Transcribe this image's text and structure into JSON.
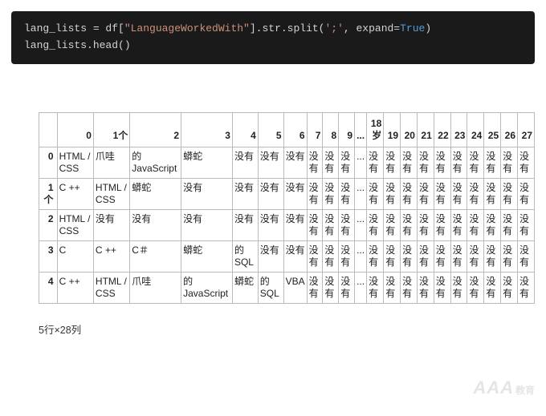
{
  "code": {
    "l1": {
      "a": "lang_lists = df[",
      "s1": "\"LanguageWorkedWith\"",
      "b": "].str.split(",
      "s2": "';'",
      "c": ", expand=",
      "kw": "True",
      "d": ")"
    },
    "l2": "lang_lists.head()"
  },
  "columns": [
    "0",
    "1个",
    "2",
    "3",
    "4",
    "5",
    "6",
    "7",
    "8",
    "9",
    "...",
    "18岁",
    "19",
    "20",
    "21",
    "22",
    "23",
    "24",
    "25",
    "26",
    "27"
  ],
  "rows": [
    {
      "idx": "0",
      "cells": [
        "HTML / CSS",
        "爪哇",
        "的JavaScript",
        "蟒蛇",
        "没有",
        "没有",
        "没有",
        "没有",
        "没有",
        "没有",
        "...",
        "没有",
        "没有",
        "没有",
        "没有",
        "没有",
        "没有",
        "没有",
        "没有",
        "没有",
        "没有"
      ]
    },
    {
      "idx": "1个",
      "cells": [
        "C ++",
        "HTML / CSS",
        "蟒蛇",
        "没有",
        "没有",
        "没有",
        "没有",
        "没有",
        "没有",
        "没有",
        "...",
        "没有",
        "没有",
        "没有",
        "没有",
        "没有",
        "没有",
        "没有",
        "没有",
        "没有",
        "没有"
      ]
    },
    {
      "idx": "2",
      "cells": [
        "HTML / CSS",
        "没有",
        "没有",
        "没有",
        "没有",
        "没有",
        "没有",
        "没有",
        "没有",
        "没有",
        "...",
        "没有",
        "没有",
        "没有",
        "没有",
        "没有",
        "没有",
        "没有",
        "没有",
        "没有",
        "没有"
      ]
    },
    {
      "idx": "3",
      "cells": [
        "C",
        "C ++",
        "C＃",
        "蟒蛇",
        "的SQL",
        "没有",
        "没有",
        "没有",
        "没有",
        "没有",
        "...",
        "没有",
        "没有",
        "没有",
        "没有",
        "没有",
        "没有",
        "没有",
        "没有",
        "没有",
        "没有"
      ]
    },
    {
      "idx": "4",
      "cells": [
        "C ++",
        "HTML / CSS",
        "爪哇",
        "的JavaScript",
        "蟒蛇",
        "的SQL",
        "VBA",
        "没有",
        "没有",
        "没有",
        "...",
        "没有",
        "没有",
        "没有",
        "没有",
        "没有",
        "没有",
        "没有",
        "没有",
        "没有",
        "没有"
      ]
    }
  ],
  "shape_text": "5行×28列",
  "watermark": {
    "main": "AAA",
    "sub": "教育"
  }
}
